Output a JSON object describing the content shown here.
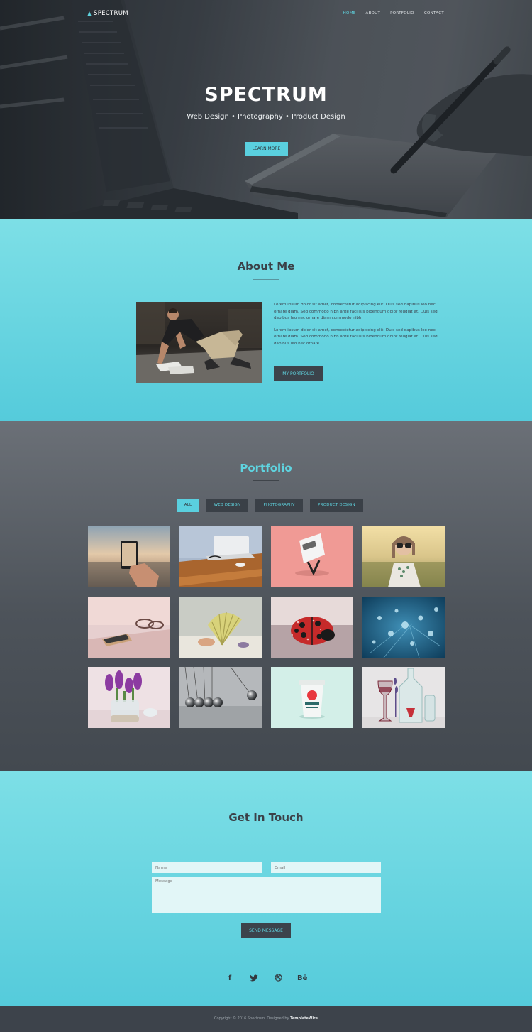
{
  "brand": {
    "name": "SPECTRUM",
    "accent": "#5fd4e0"
  },
  "nav": {
    "items": [
      "HOME",
      "ABOUT",
      "PORTFOLIO",
      "CONTACT"
    ],
    "active": "HOME"
  },
  "hero": {
    "title": "SPECTRUM",
    "subtitle": "Web Design • Photography • Product Design",
    "button": "LEARN MORE"
  },
  "about": {
    "title": "About Me",
    "paragraphs": [
      "Lorem ipsum dolor sit amet, consectetur adipiscing elit. Duis sed dapibus leo nec ornare diam. Sed commodo nibh ante facilisis bibendum dolor feugiat at. Duis sed dapibus leo nec ornare diam commodo nibh.",
      "Lorem ipsum dolor sit amet, consectetur adipiscing elit. Duis sed dapibus leo nec ornare diam. Sed commodo nibh ante facilisis bibendum dolor feugiat at. Duis sed dapibus leo nec ornare."
    ],
    "button": "MY PORTFOLIO"
  },
  "portfolio": {
    "title": "Portfolio",
    "filters": [
      "ALL",
      "WEB DESIGN",
      "PHOTOGRAPHY",
      "PRODUCT DESIGN"
    ],
    "active_filter": "ALL",
    "items": [
      "phone-sunset-photo",
      "laptop-desk-photo",
      "business-card-photo",
      "woman-field-photo",
      "phone-glasses-photo",
      "seashell-photo",
      "ladybug-photo",
      "water-drops-photo",
      "flowers-jar-photo",
      "newtons-cradle-photo",
      "coffee-cup-photo",
      "glass-bottles-photo"
    ]
  },
  "contact": {
    "title": "Get In Touch",
    "name_placeholder": "Name",
    "email_placeholder": "Email",
    "message_placeholder": "Message",
    "button": "SEND MESSAGE",
    "social": [
      "facebook-icon",
      "twitter-icon",
      "dribbble-icon",
      "behance-icon"
    ]
  },
  "footer": {
    "text": "Copyright © 2016 Spectrum. Designed by",
    "credit": "TemplateWire"
  }
}
